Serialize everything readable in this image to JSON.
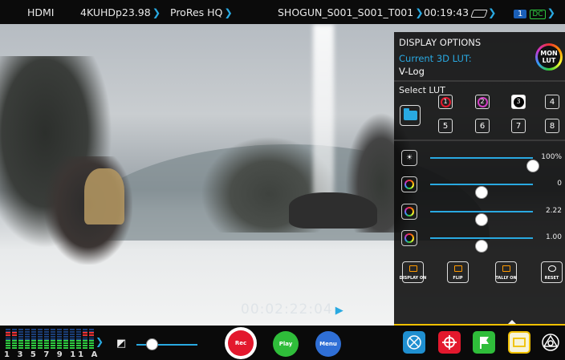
{
  "topbar": {
    "input": "HDMI",
    "format": "4KUHDp23.98",
    "codec": "ProRes HQ",
    "filename": "SHOGUN_S001_S001_T001",
    "remaining": "00:19:43",
    "slot": "1",
    "power": "DC"
  },
  "video": {
    "timecode": "00:02:22:04"
  },
  "panel": {
    "title": "DISPLAY OPTIONS",
    "current_lut_label": "Current 3D LUT:",
    "current_lut_value": "V-Log",
    "monlut_label_1": "MON",
    "monlut_label_2": "LUT",
    "select_lut_label": "Select LUT",
    "lut_slots": [
      "1",
      "2",
      "3",
      "4",
      "5",
      "6",
      "7",
      "8"
    ],
    "lut_slot_colors": [
      "#e3182d",
      "#d13fc3",
      "#ffffff",
      "",
      "",
      "",
      "",
      ""
    ],
    "active_lut": "3",
    "sliders": [
      {
        "icon": "brightness-icon",
        "value_label": "100%",
        "level": 1.0
      },
      {
        "icon": "lut-adjust-icon",
        "value_label": "0",
        "level": 0.5
      },
      {
        "icon": "gamma-icon",
        "value_label": "2.22",
        "level": 0.5
      },
      {
        "icon": "gain-icon",
        "value_label": "1.00",
        "level": 0.5
      }
    ],
    "buttons": {
      "display_on": "DISPLAY ON",
      "flip": "FLIP",
      "tally_on": "TALLY ON",
      "reset": "RESET"
    }
  },
  "bottombar": {
    "meter_labels": "1 3 5 7 9 11 A",
    "volume_level": 0.25,
    "rec_label": "Rec",
    "play_label": "Play",
    "menu_label": "Menu",
    "accent_color": "#29a9e1"
  }
}
